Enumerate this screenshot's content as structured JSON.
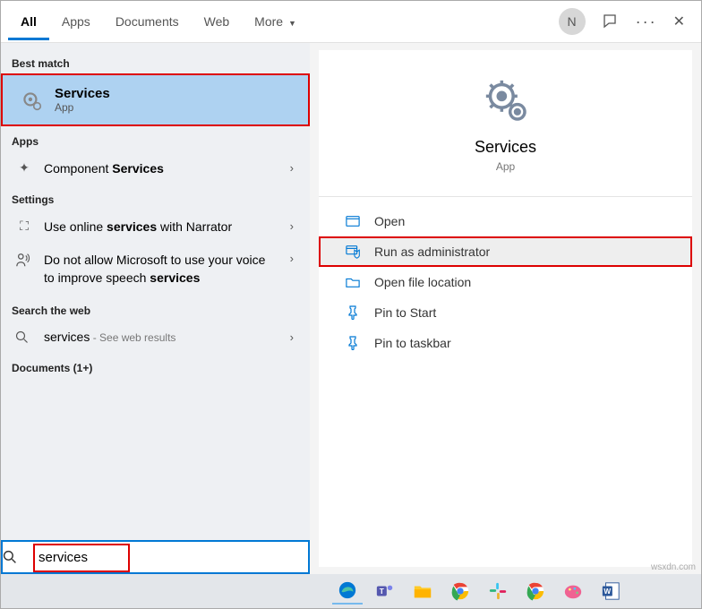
{
  "header": {
    "tabs": [
      "All",
      "Apps",
      "Documents",
      "Web",
      "More"
    ],
    "avatar_initial": "N"
  },
  "left": {
    "best_match_label": "Best match",
    "best_match": {
      "title": "Services",
      "subtitle": "App"
    },
    "apps_label": "Apps",
    "apps": [
      {
        "text_pre": "Component ",
        "text_bold": "Services"
      }
    ],
    "settings_label": "Settings",
    "settings": [
      {
        "icon": "⧉",
        "pre": "Use online ",
        "bold": "services",
        "post": " with Narrator"
      },
      {
        "icon": "👤",
        "pre": "Do not allow Microsoft to use your voice to improve speech ",
        "bold": "services",
        "post": ""
      }
    ],
    "web_label": "Search the web",
    "web": {
      "icon": "🔍",
      "pre": "services",
      "post": " - See web results"
    },
    "docs_label": "Documents (1+)"
  },
  "preview": {
    "title": "Services",
    "subtitle": "App",
    "actions": [
      {
        "icon": "⊡",
        "label": "Open"
      },
      {
        "icon": "⛊",
        "label": "Run as administrator",
        "selected": true
      },
      {
        "icon": "🗀",
        "label": "Open file location"
      },
      {
        "icon": "⊟",
        "label": "Pin to Start"
      },
      {
        "icon": "⊟",
        "label": "Pin to taskbar"
      }
    ]
  },
  "search": {
    "value": "services"
  },
  "watermark": "wsxdn.com"
}
